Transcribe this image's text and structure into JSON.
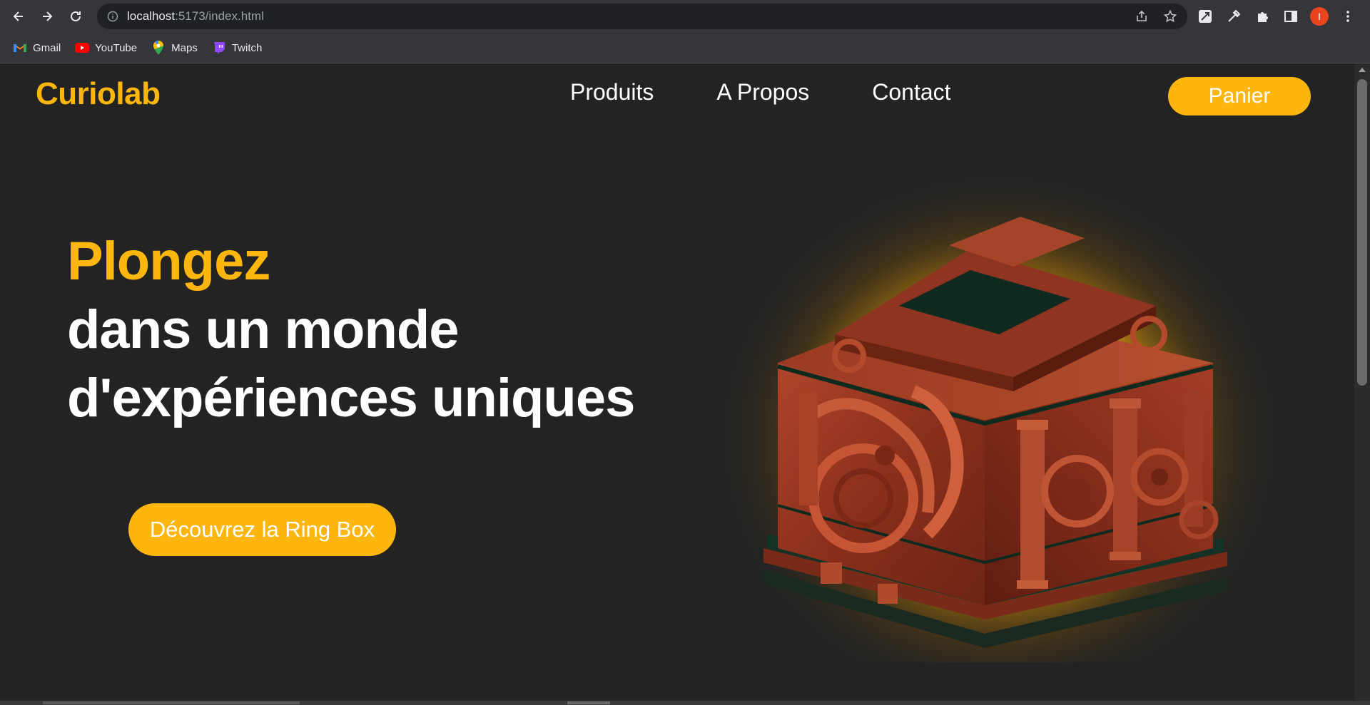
{
  "browser": {
    "url_host": "localhost",
    "url_path": ":5173/index.html",
    "profile_initial": "I",
    "bookmarks": [
      {
        "label": "Gmail",
        "icon": "gmail-icon"
      },
      {
        "label": "YouTube",
        "icon": "youtube-icon"
      },
      {
        "label": "Maps",
        "icon": "maps-icon"
      },
      {
        "label": "Twitch",
        "icon": "twitch-icon"
      }
    ]
  },
  "site": {
    "logo": "Curiolab",
    "nav": [
      "Produits",
      "A Propos",
      "Contact"
    ],
    "cart_label": "Panier",
    "hero": {
      "highlight": "Plongez",
      "line1": "dans un monde",
      "line2": "d'expériences uniques",
      "cta_label": "Découvrez la Ring Box"
    }
  },
  "colors": {
    "accent": "#fdb60d",
    "background": "#232323",
    "text": "#ffffff",
    "product_wood": "#9a3a22"
  }
}
